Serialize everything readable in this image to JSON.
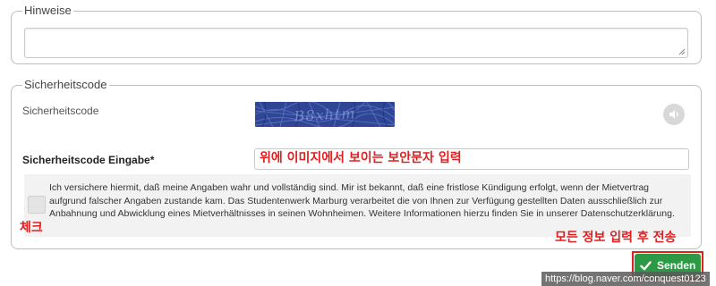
{
  "hinweise": {
    "legend": "Hinweise",
    "textarea_value": ""
  },
  "sicherheitscode": {
    "legend": "Sicherheitscode",
    "image_label": "Sicherheitscode",
    "captcha_text": "B8xhtm",
    "audio_icon": "speaker-icon",
    "input_label": "Sicherheitscode Eingabe*",
    "input_value": ""
  },
  "consent": {
    "text": "Ich versichere hiermit, daß meine Angaben wahr und vollständig sind. Mir ist bekannt, daß eine fristlose Kündigung erfolgt, wenn der Mietvertrag aufgrund falscher Angaben zustande kam. Das Studentenwerk Marburg verarbeitet die von Ihnen zur Verfügung gestellten Daten ausschließlich zur Anbahnung und Abwicklung eines Mietverhältnisses in seinen Wohnheimen. Weitere Informationen hierzu finden Sie in unserer Datenschutzerklärung.",
    "checked": false
  },
  "annotations": {
    "input_note": "위에 이미지에서 보이는 보안문자 입력",
    "check_note": "체크",
    "send_note": "모든 정보 입력 후 전송"
  },
  "send_button": {
    "label": "Senden",
    "icon": "check-icon"
  },
  "watermark": "https://blog.naver.com/conquest0123",
  "colors": {
    "accent_green": "#2c9a44",
    "annotation_red": "#e02020",
    "captcha_blue": "#2a3f8f"
  }
}
